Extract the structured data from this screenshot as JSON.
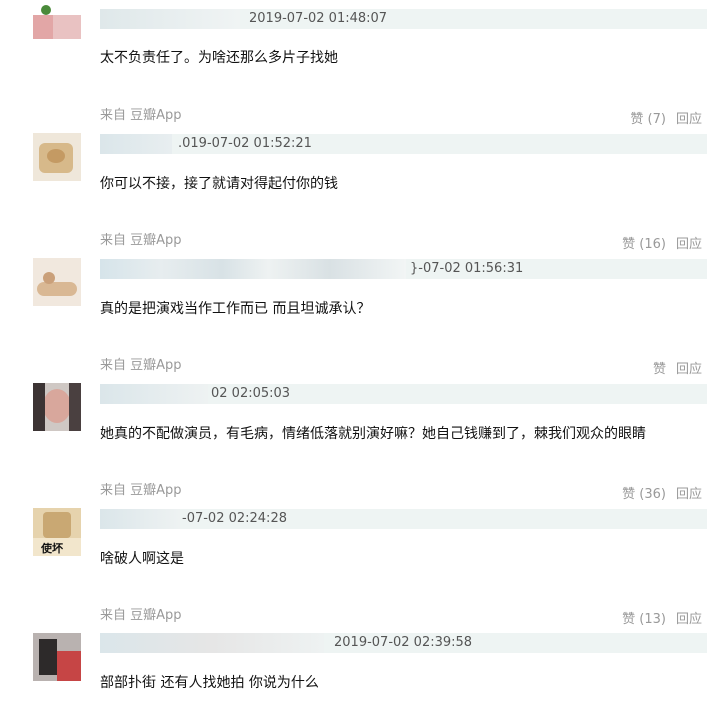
{
  "comments": [
    {
      "time": "2019-07-02 01:48:07",
      "text": "太不负责任了。为啥还那么多片子找她",
      "source": "来自 豆瓣App",
      "likes": "赞 (7)",
      "reply": "回应"
    },
    {
      "time": ".019-07-02 01:52:21",
      "text": "你可以不接，接了就请对得起付你的钱",
      "source": "来自 豆瓣App",
      "likes": "赞 (16)",
      "reply": "回应"
    },
    {
      "time": "}-07-02 01:56:31",
      "text": "真的是把演戏当作工作而已 而且坦诚承认？",
      "source": "来自 豆瓣App",
      "likes": "赞",
      "reply": "回应"
    },
    {
      "time": "02 02:05:03",
      "text": "她真的不配做演员，有毛病，情绪低落就别演好嘛？她自己钱赚到了，棘我们观众的眼睛",
      "source": "来自 豆瓣App",
      "likes": "赞 (36)",
      "reply": "回应"
    },
    {
      "time": "-07-02 02:24:28",
      "text": "啥破人啊这是",
      "avatar_label": "使坏",
      "source": "来自 豆瓣App",
      "likes": "赞 (13)",
      "reply": "回应"
    },
    {
      "time": "2019-07-02 02:39:58",
      "text": "部部扑街 还有人找她拍 你说为什么"
    }
  ],
  "colors": {
    "meta_bar": "#eef4f3",
    "secondary_text": "#999999",
    "body_text": "#111111"
  }
}
